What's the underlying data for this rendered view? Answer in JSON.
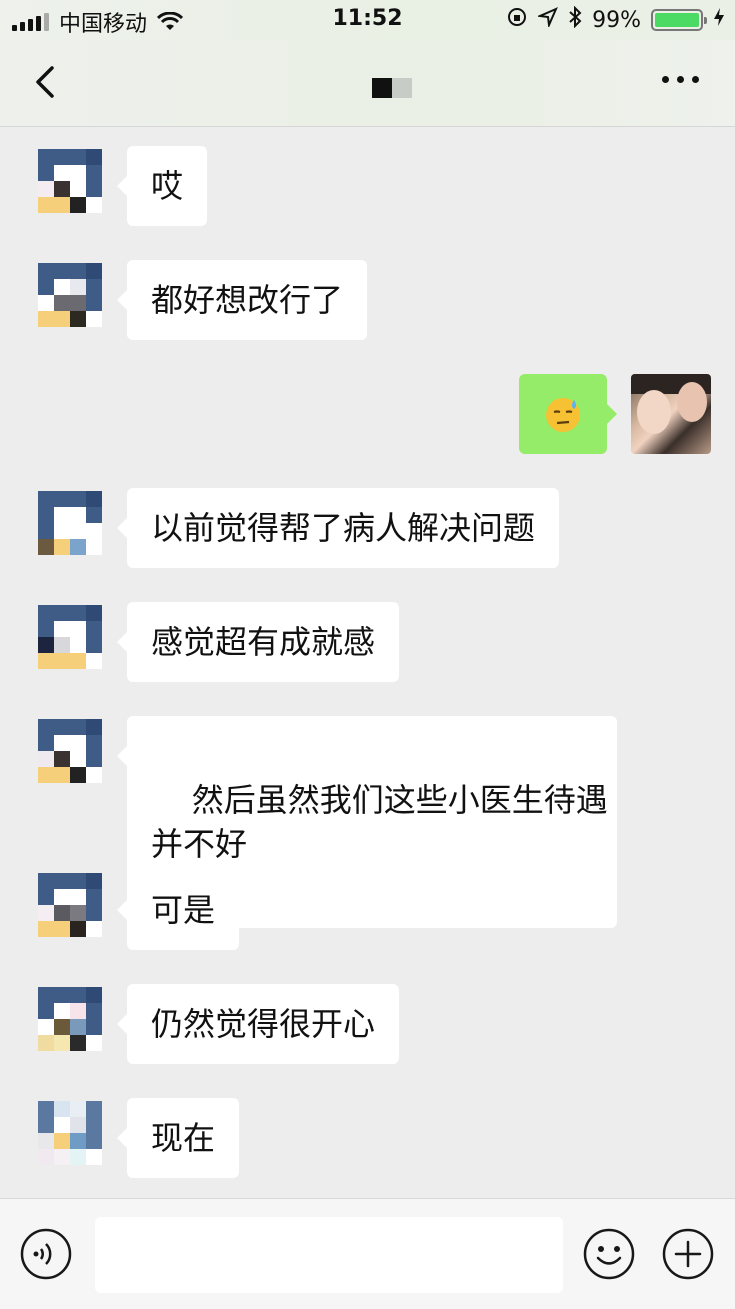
{
  "status_bar": {
    "carrier": "中国移动",
    "time": "11:52",
    "battery_percent": "99%",
    "battery_level": 0.99
  },
  "header": {
    "back_icon": "chevron-left-icon",
    "more_icon": "ellipsis-icon"
  },
  "messages": [
    {
      "side": "left",
      "text": "哎"
    },
    {
      "side": "left",
      "text": "都好想改行了"
    },
    {
      "side": "right",
      "emoji": "😓"
    },
    {
      "side": "left",
      "text": "以前觉得帮了病人解决问题"
    },
    {
      "side": "left",
      "text": "感觉超有成就感"
    },
    {
      "side": "left",
      "text": "然后虽然我们这些小医生待遇\n并不好"
    },
    {
      "side": "left",
      "text": "可是"
    },
    {
      "side": "left",
      "text": "仍然觉得很开心"
    },
    {
      "side": "left",
      "text": "现在"
    }
  ],
  "input_bar": {
    "voice_icon": "voice-icon",
    "emoji_icon": "emoji-icon",
    "plus_icon": "plus-icon",
    "input_value": ""
  }
}
